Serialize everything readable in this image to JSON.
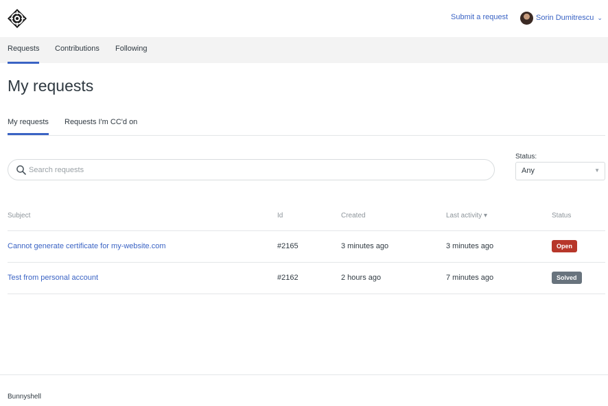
{
  "header": {
    "logo_icon": "crosshair-diamond-logo-icon",
    "submit_request_label": "Submit a request",
    "user_name": "Sorin Dumitrescu",
    "user_chevron_icon": "chevron-down-icon"
  },
  "subnav": {
    "items": [
      {
        "label": "Requests",
        "active": true
      },
      {
        "label": "Contributions",
        "active": false
      },
      {
        "label": "Following",
        "active": false
      }
    ]
  },
  "page": {
    "title": "My requests"
  },
  "tabs": [
    {
      "label": "My requests",
      "active": true
    },
    {
      "label": "Requests I'm CC'd on",
      "active": false
    }
  ],
  "search": {
    "placeholder": "Search requests",
    "value": "",
    "icon": "search-icon"
  },
  "status_filter": {
    "label": "Status:",
    "selected": "Any"
  },
  "table": {
    "columns": [
      "Subject",
      "Id",
      "Created",
      "Last activity",
      "Status"
    ],
    "sort_indicator": "▾",
    "rows": [
      {
        "subject": "Cannot generate certificate for my-website.com",
        "id": "#2165",
        "created": "3 minutes ago",
        "last_activity": "3 minutes ago",
        "status": "Open",
        "status_color": "#b7372a"
      },
      {
        "subject": "Test from personal account",
        "id": "#2162",
        "created": "2 hours ago",
        "last_activity": "7 minutes ago",
        "status": "Solved",
        "status_color": "#68737d"
      }
    ]
  },
  "footer": {
    "text": "Bunnyshell"
  },
  "colors": {
    "accent": "#3a63c4",
    "subnav_bg": "#f3f3f3",
    "border": "#e3e6e8"
  }
}
